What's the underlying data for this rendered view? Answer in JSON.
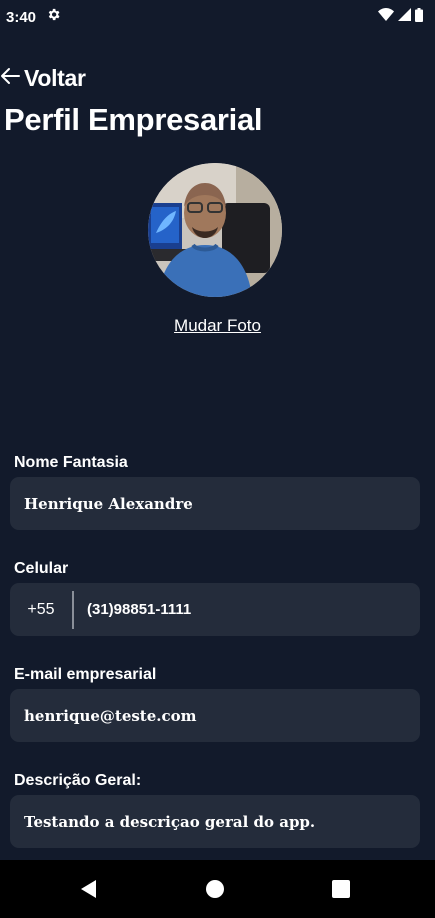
{
  "status_bar": {
    "time": "3:40",
    "icons": [
      "gear-icon",
      "wifi-icon",
      "cell-signal-icon",
      "battery-icon"
    ]
  },
  "header": {
    "back_label": "Voltar",
    "title": "Perfil Empresarial"
  },
  "profile": {
    "change_photo_label": "Mudar Foto"
  },
  "form": {
    "trade_name": {
      "label": "Nome Fantasia",
      "value": "Henrique Alexandre"
    },
    "phone": {
      "label": "Celular",
      "country_code": "+55",
      "value": "(31)98851-1111"
    },
    "email": {
      "label": "E-mail empresarial",
      "value": "henrique@teste.com"
    },
    "description": {
      "label": "Descrição Geral:",
      "value": "Testando a descriçao geral do app."
    }
  },
  "nav_bar": {
    "icons": [
      "back-triangle-icon",
      "home-circle-icon",
      "recents-square-icon"
    ]
  },
  "colors": {
    "background": "#121a2b",
    "field_background": "#242c3b",
    "text": "#ffffff",
    "nav_background": "#000000"
  }
}
